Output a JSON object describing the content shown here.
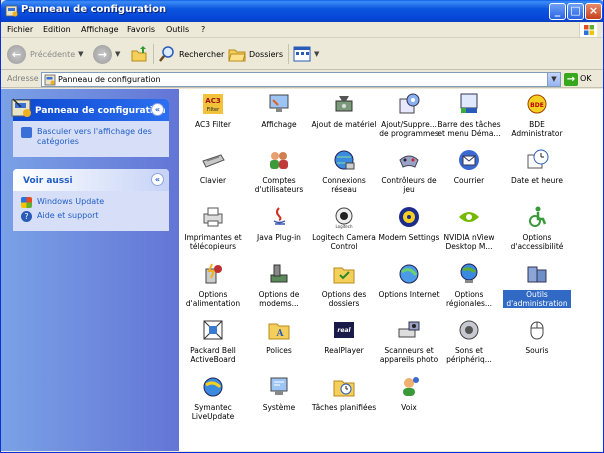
{
  "window": {
    "title": "Panneau de configuration"
  },
  "menu": [
    "Fichier",
    "Edition",
    "Affichage",
    "Favoris",
    "Outils",
    "?"
  ],
  "toolbar": {
    "back": "Précédente",
    "search": "Rechercher",
    "folders": "Dossiers"
  },
  "address": {
    "label": "Adresse",
    "value": "Panneau de configuration",
    "go": "OK"
  },
  "sidebar": {
    "panel_title": "Panneau de configuration",
    "switch_view": "Basculer vers l'affichage des catégories",
    "see_also_title": "Voir aussi",
    "links": [
      "Windows Update",
      "Aide et support"
    ]
  },
  "items": [
    "AC3 Filter",
    "Affichage",
    "Ajout de matériel",
    "Ajout/Suppre... de programmes",
    "Barre des tâches et menu Déma...",
    "BDE Administrator",
    "Clavier",
    "Comptes d'utilisateurs",
    "Connexions réseau",
    "Contrôleurs de jeu",
    "Courrier",
    "Date et heure",
    "Imprimantes et télécopieurs",
    "Java Plug-in",
    "Logitech Camera Control",
    "Modem Settings",
    "NVIDIA nView Desktop M...",
    "Options d'accessibilité",
    "Options d'alimentation",
    "Options de modems...",
    "Options des dossiers",
    "Options Internet",
    "Options régionales...",
    "Outils d'administration",
    "Packard Bell ActiveBoard",
    "Polices",
    "RealPlayer",
    "Scanneurs et appareils photo",
    "Sons et périphériq...",
    "Souris",
    "Symantec LiveUpdate",
    "Système",
    "Tâches planifiées",
    "Voix"
  ],
  "selected_item": "Outils d'administration",
  "colors": {
    "titlebar": "#0a55e0",
    "sidebar": "#6f8fe0",
    "selection": "#316ac5",
    "link": "#215dc6"
  }
}
